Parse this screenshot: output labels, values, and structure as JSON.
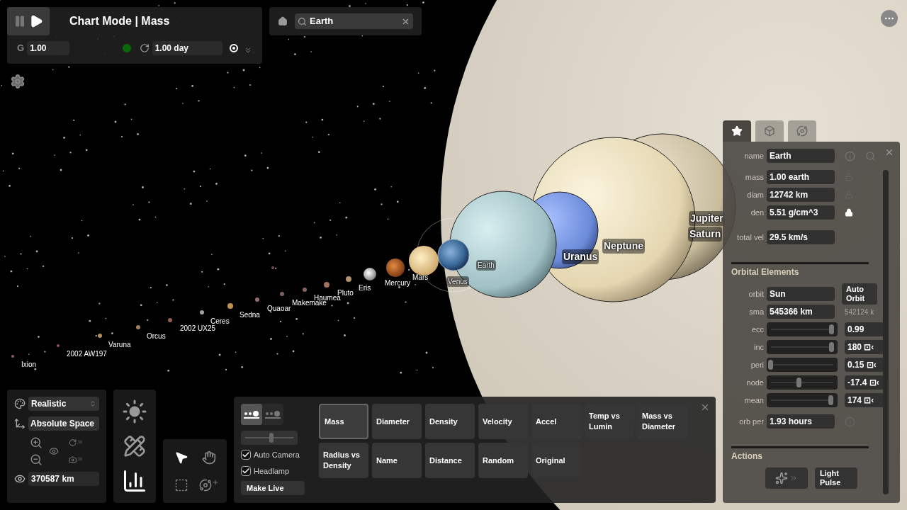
{
  "title": "Chart Mode | Mass",
  "gravity": {
    "label": "G",
    "value": "1.00"
  },
  "time_step": {
    "value": "1.00 day"
  },
  "search": {
    "value": "Earth"
  },
  "body_labels": [
    "Jupiter",
    "Saturn",
    "Neptune",
    "Uranus",
    "Earth",
    "Venus",
    "Mars",
    "Mercury",
    "Eris",
    "Pluto",
    "Haumea",
    "Makemake",
    "Quaoar",
    "Sedna",
    "Ceres",
    "2002 UX25",
    "Orcus",
    "Varuna",
    "2002 AW197",
    "Ixion"
  ],
  "view": {
    "appearance": "Realistic",
    "frame": "Absolute Space",
    "distance": "370587 km"
  },
  "camera_options": [
    {
      "label": "Auto Camera",
      "checked": true
    },
    {
      "label": "Headlamp",
      "checked": true
    }
  ],
  "make_live": "Make Live",
  "view_tabs": [
    {
      "selected": true
    },
    {
      "selected": false
    }
  ],
  "zoom_slider": {
    "level": 0.55
  },
  "chart_modes": [
    {
      "label": "Mass",
      "selected": true
    },
    {
      "label": "Diameter",
      "selected": false
    },
    {
      "label": "Density",
      "selected": false
    },
    {
      "label": "Velocity",
      "selected": false
    },
    {
      "label": "Accel",
      "selected": false
    },
    {
      "label": "Temp vs Lumin",
      "selected": false
    },
    {
      "label": "Mass vs Diameter",
      "selected": false
    },
    {
      "label": "Radius vs Density",
      "selected": false
    },
    {
      "label": "Name",
      "selected": false
    },
    {
      "label": "Distance",
      "selected": false
    },
    {
      "label": "Random",
      "selected": false
    },
    {
      "label": "Original",
      "selected": false
    }
  ],
  "panel_tabs": [
    {
      "selected": true
    },
    {
      "selected": false
    },
    {
      "selected": false
    }
  ],
  "properties": {
    "name": {
      "label": "name",
      "value": "Earth"
    },
    "fields": [
      {
        "label": "mass",
        "value": "1.00 earth",
        "locked": false
      },
      {
        "label": "diam",
        "value": "12742 km",
        "locked": false
      },
      {
        "label": "den",
        "value": "5.51 g/cm^3",
        "locked": true
      }
    ],
    "total_vel": {
      "label": "total vel",
      "value": "29.5 km/s"
    }
  },
  "orbital": {
    "heading": "Orbital Elements",
    "orbit": {
      "label": "orbit",
      "value": "Sun"
    },
    "auto_orbit": "Auto Orbit",
    "sma": {
      "label": "sma",
      "value": "545366 km",
      "hint": "542124 k"
    },
    "sliders": [
      {
        "label": "ecc",
        "level": 0.97,
        "value": "0.99"
      },
      {
        "label": "inc",
        "level": 0.97,
        "value": "180 ⊡‹"
      },
      {
        "label": "peri",
        "level": 0.0,
        "value": "0.15 ⊡‹"
      },
      {
        "label": "node",
        "level": 0.45,
        "value": "-17.4 ⊡‹"
      },
      {
        "label": "mean",
        "level": 0.96,
        "value": "174 ⊡‹"
      }
    ],
    "period": {
      "label": "orb per",
      "value": "1.93 hours"
    }
  },
  "actions": {
    "heading": "Actions",
    "light_pulse": "Light Pulse"
  }
}
